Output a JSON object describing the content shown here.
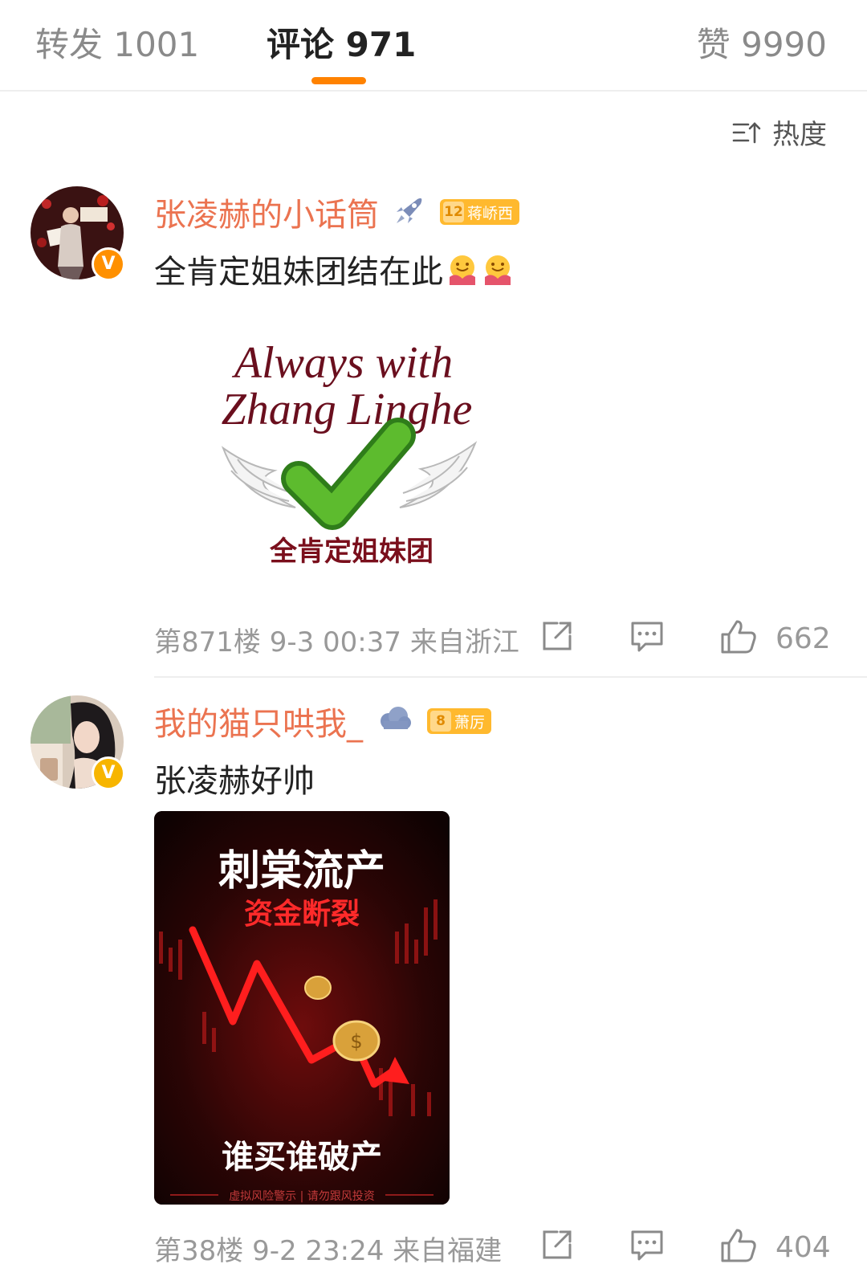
{
  "tabs": {
    "repost": "转发 1001",
    "comments": "评论 971",
    "likes": "赞 9990"
  },
  "sort": {
    "label": "热度",
    "icon": "sort-icon"
  },
  "comments": [
    {
      "username": "张凌赫的小话筒",
      "badge_level": "12",
      "badge_text": "蒋峤西",
      "text": "全肯定姐妹团结在此",
      "image": {
        "title_line1": "Always with",
        "title_line2": "Zhang Linghe",
        "caption": "全肯定姐妹团"
      },
      "meta": "第871楼 9-3 00:37 来自浙江",
      "likes": "662"
    },
    {
      "username": "我的猫只哄我_",
      "badge_level": "8",
      "badge_text": "萧厉",
      "text": "张凌赫好帅",
      "image": {
        "headline": "刺棠流产",
        "subheadline": "资金断裂",
        "slogan": "谁买谁破产",
        "footer": "虚拟风险警示 | 请勿跟风投资"
      },
      "meta": "第38楼 9-2 23:24 来自福建",
      "likes": "404"
    }
  ],
  "colors": {
    "accent": "#ff8200",
    "username": "#eb7350",
    "badge": "#ffb92e",
    "muted": "#999999"
  }
}
